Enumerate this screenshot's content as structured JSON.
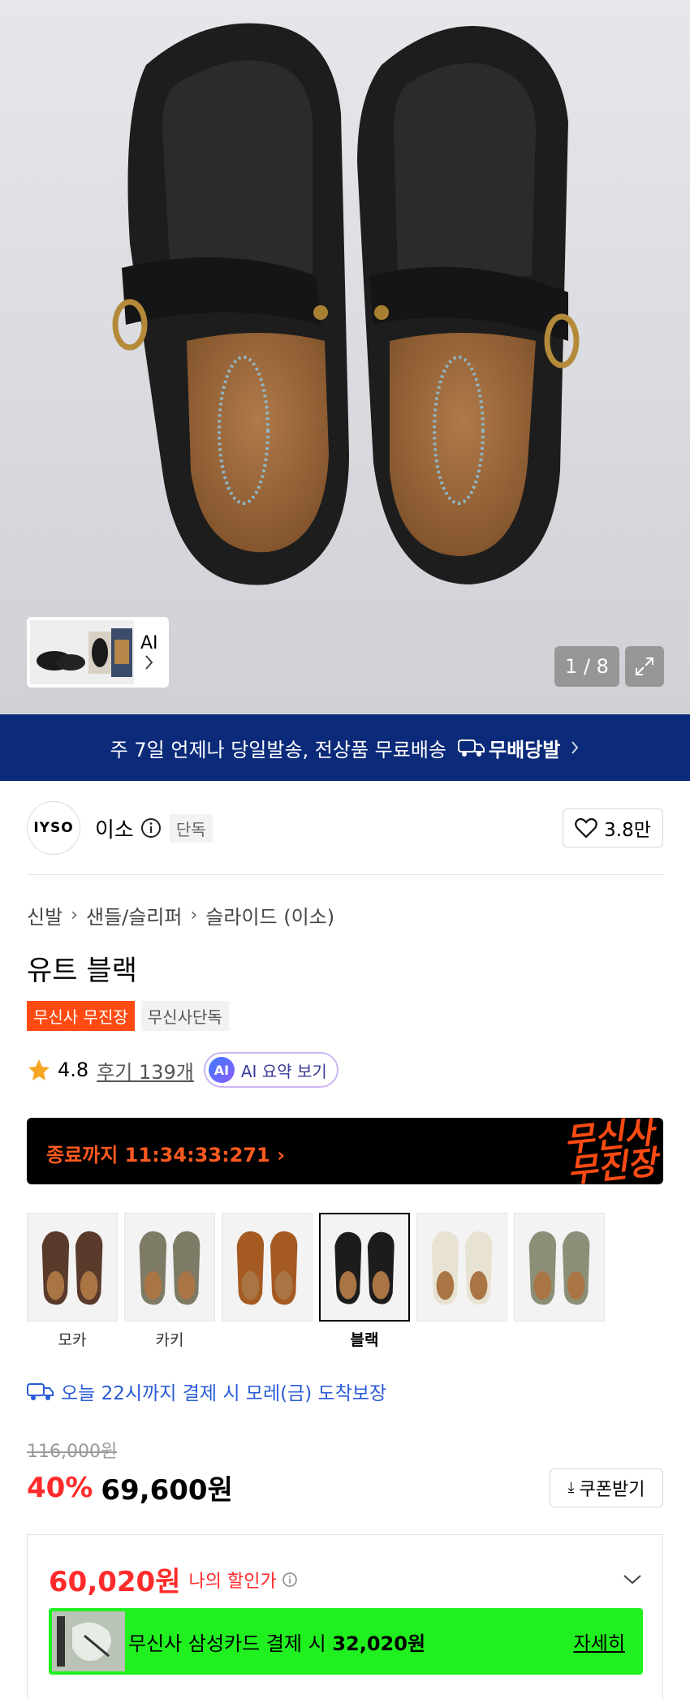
{
  "hero": {
    "thumb_ai_label": "AI",
    "counter": "1 / 8"
  },
  "banner": {
    "text": "주 7일 언제나 당일발송, 전상품 무료배송",
    "logo_text": "무배당발"
  },
  "brand": {
    "logo_text": "IYSO",
    "name": "이소",
    "exclusive": "단독",
    "likes": "3.8만"
  },
  "breadcrumb": [
    "신발",
    "샌들/슬리퍼",
    "슬라이드 (이소)"
  ],
  "product": {
    "title": "유트 블랙",
    "tag_primary": "무신사 무진장",
    "tag_secondary": "무신사단독",
    "rating": "4.8",
    "reviews": "후기 139개",
    "ai_badge": "AI",
    "ai_summary": "AI 요약 보기"
  },
  "timer": {
    "text": "종료까지 11:34:33:271",
    "brand_line1": "무신사",
    "brand_line2": "무진장"
  },
  "colors": {
    "accent_orange": "#ff4b12",
    "banner_blue": "#0b2a7a",
    "price_red": "#ff2a2a",
    "delivery_blue": "#2a5bd7",
    "promo_green": "#21f020"
  },
  "swatches": [
    {
      "label": "모카",
      "color": "#5a3a2a",
      "selected": false
    },
    {
      "label": "카키",
      "color": "#7d7a66",
      "selected": false
    },
    {
      "label": "",
      "color": "#a55a22",
      "selected": false
    },
    {
      "label": "블랙",
      "color": "#1c1c1c",
      "selected": true
    },
    {
      "label": "",
      "color": "#e8e2d2",
      "selected": false
    },
    {
      "label": "",
      "color": "#8c8f78",
      "selected": false
    }
  ],
  "delivery": "오늘 22시까지 결제 시 모레(금) 도착보장",
  "price": {
    "original": "116,000원",
    "discount": "40%",
    "sale": "69,600원",
    "coupon": "쿠폰받기"
  },
  "my_price": {
    "amount": "60,020원",
    "label": "나의 할인가",
    "card_text": "무신사 삼성카드 결제 시",
    "card_amount": "32,020원",
    "detail": "자세히"
  }
}
